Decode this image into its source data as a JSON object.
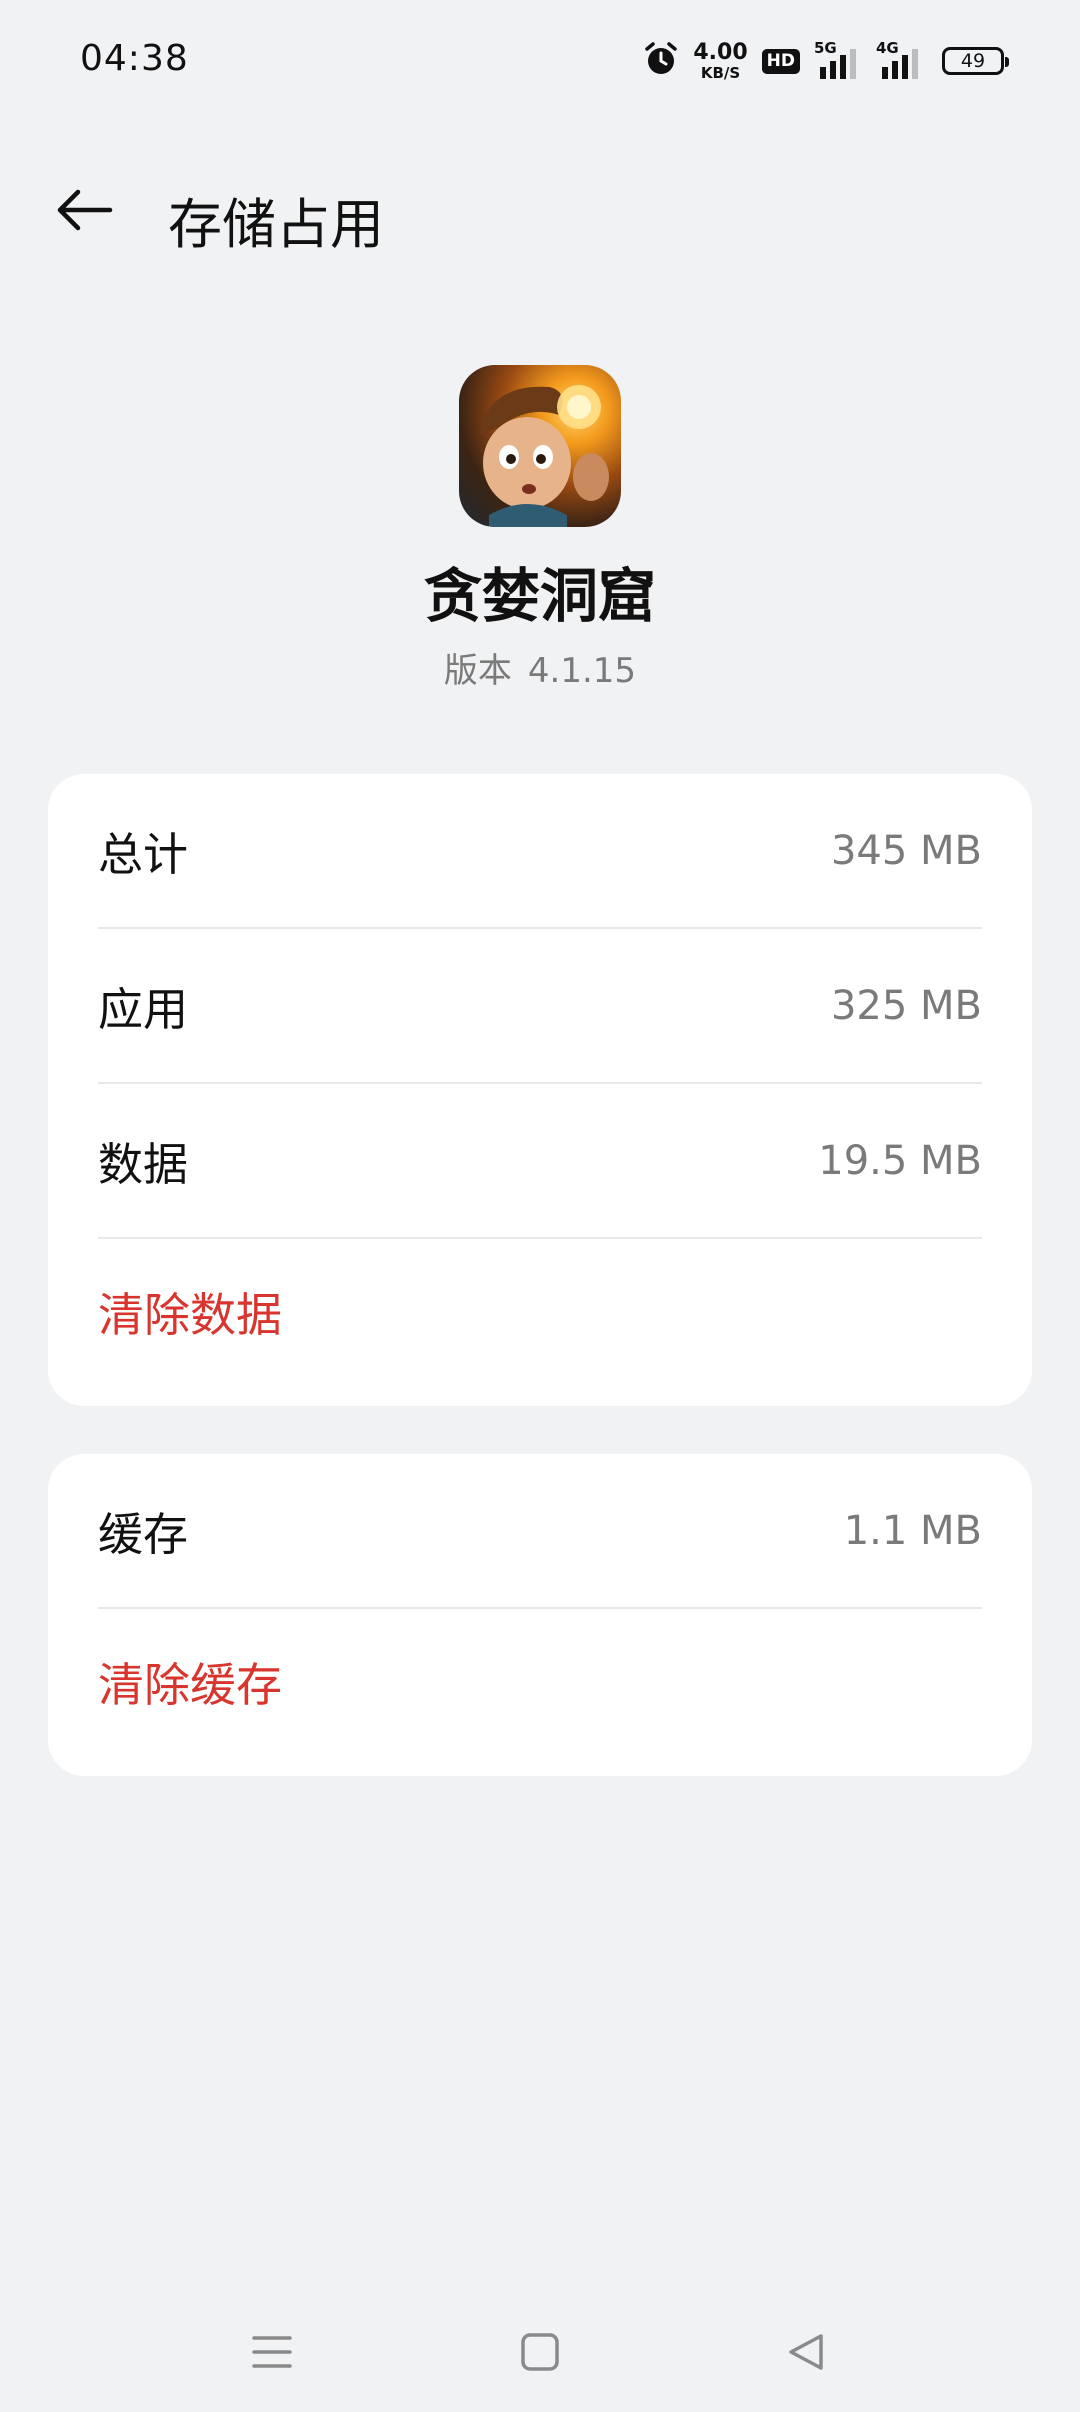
{
  "status_bar": {
    "time": "04:38",
    "net_speed_value": "4.00",
    "net_speed_unit": "KB/S",
    "hd_label": "HD",
    "signal_1_label": "5G",
    "signal_2_label": "4G",
    "battery_level": "49",
    "icons": [
      "alarm-icon",
      "hd-icon",
      "signal-5g-icon",
      "signal-4g-icon",
      "battery-icon"
    ]
  },
  "header": {
    "title": "存储占用",
    "back_icon": "back-arrow-icon"
  },
  "app": {
    "name": "贪婪洞窟",
    "version_label": "版本",
    "version": "4.1.15"
  },
  "storage_card": {
    "rows": [
      {
        "label": "总计",
        "value": "345 MB"
      },
      {
        "label": "应用",
        "value": "325 MB"
      },
      {
        "label": "数据",
        "value": "19.5 MB"
      }
    ],
    "action_label": "清除数据"
  },
  "cache_card": {
    "rows": [
      {
        "label": "缓存",
        "value": "1.1 MB"
      }
    ],
    "action_label": "清除缓存"
  },
  "nav_bar": {
    "icons": [
      "menu-icon",
      "home-icon",
      "back-triangle-icon"
    ]
  },
  "colors": {
    "background": "#f1f2f4",
    "card": "#ffffff",
    "danger": "#d8352e",
    "secondary_text": "#7a7a7a"
  }
}
